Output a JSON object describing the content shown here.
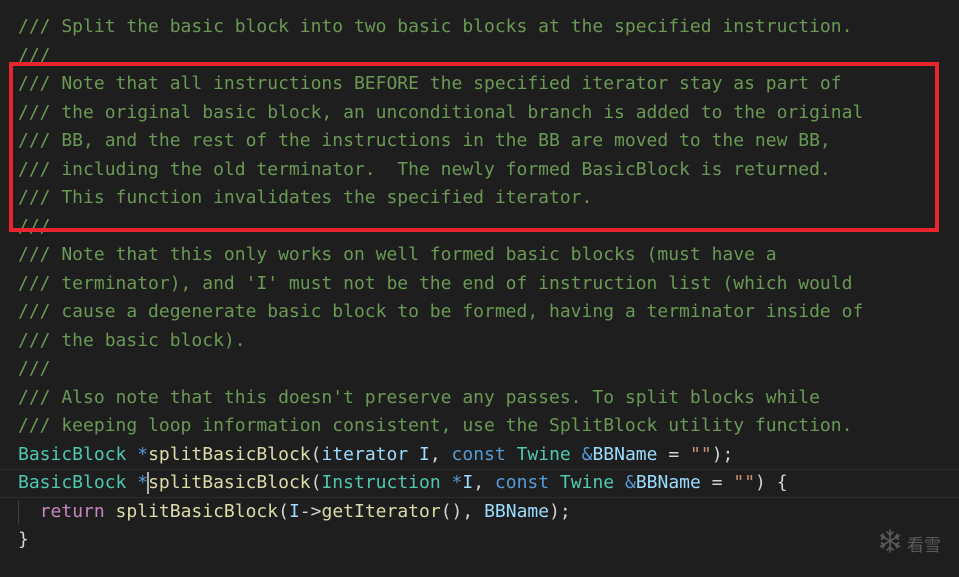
{
  "annotation": {
    "color": "#e8242f"
  },
  "watermark": {
    "icon": "snowflake-icon",
    "text": "看雪"
  },
  "comment_lines": [
    "/// Split the basic block into two basic blocks at the specified instruction.",
    "///",
    "/// Note that all instructions BEFORE the specified iterator stay as part of",
    "/// the original basic block, an unconditional branch is added to the original",
    "/// BB, and the rest of the instructions in the BB are moved to the new BB,",
    "/// including the old terminator.  The newly formed BasicBlock is returned.",
    "/// This function invalidates the specified iterator.",
    "///",
    "/// Note that this only works on well formed basic blocks (must have a",
    "/// terminator), and 'I' must not be the end of instruction list (which would",
    "/// cause a degenerate basic block to be formed, having a terminator inside of",
    "/// the basic block).",
    "///",
    "/// Also note that this doesn't preserve any passes. To split blocks while",
    "/// keeping loop information consistent, use the SplitBlock utility function."
  ],
  "code": {
    "decl1": {
      "type": "BasicBlock",
      "ptr": " *",
      "fn": "splitBasicBlock",
      "open": "(",
      "param1_type": "iterator",
      "param1_name": " I",
      "sep": ", ",
      "kw_const": "const",
      "param2_type": " Twine",
      "amp": " &",
      "param2_name": "BBName",
      "eq": " = ",
      "default": "\"\"",
      "close": ");"
    },
    "decl2": {
      "type": "BasicBlock",
      "ptr": " *",
      "fn": "splitBasicBlock",
      "open": "(",
      "param1_type": "Instruction",
      "param1_ptr": " *",
      "param1_name": "I",
      "sep": ", ",
      "kw_const": "const",
      "param2_type": " Twine",
      "amp": " &",
      "param2_name": "BBName",
      "eq": " = ",
      "default": "\"\"",
      "close": ") {"
    },
    "body": {
      "indent": "  ",
      "kw_return": "return",
      "fn_call": " splitBasicBlock",
      "open": "(",
      "arg_obj": "I",
      "arrow": "->",
      "method": "getIterator",
      "call_parens": "(), ",
      "arg2": "BBName",
      "close": ");"
    },
    "closing_brace": "}"
  }
}
